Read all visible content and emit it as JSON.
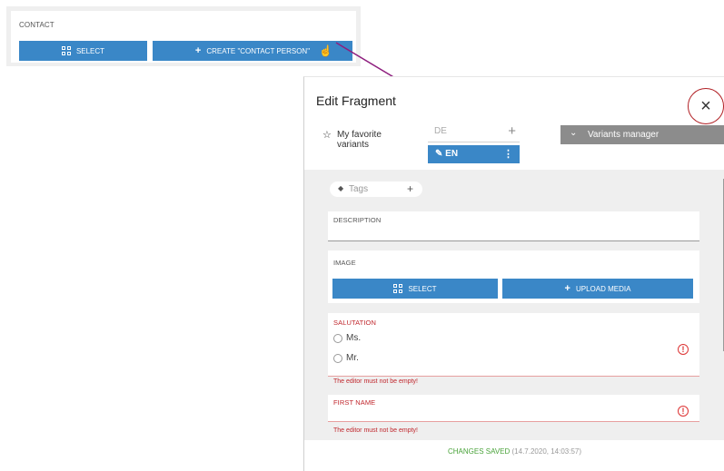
{
  "contact": {
    "title": "CONTACT",
    "select_label": "SELECT",
    "create_label": "CREATE \"CONTACT PERSON\""
  },
  "dialog": {
    "title": "Edit Fragment",
    "close_icon": "×",
    "favorite_label": "My favorite variants",
    "languages": [
      {
        "code": "DE",
        "active": false
      },
      {
        "code": "EN",
        "active": true
      }
    ],
    "variants_manager_label": "Variants manager",
    "tags_label": "Tags",
    "description_label": "DESCRIPTION",
    "image": {
      "label": "IMAGE",
      "select_label": "SELECT",
      "upload_label": "UPLOAD MEDIA"
    },
    "salutation": {
      "label": "SALUTATION",
      "options": [
        "Ms.",
        "Mr."
      ],
      "error": "The editor must not be empty!"
    },
    "first_name": {
      "label": "FIRST NAME",
      "error": "The editor must not be empty!"
    },
    "footer": {
      "status": "CHANGES SAVED",
      "timestamp": "(14.7.2020, 14:03:57)"
    }
  },
  "colors": {
    "accent": "#3a87c7",
    "error": "#c0272d",
    "success": "#4aa33a",
    "arrow": "#8e1e7e"
  }
}
